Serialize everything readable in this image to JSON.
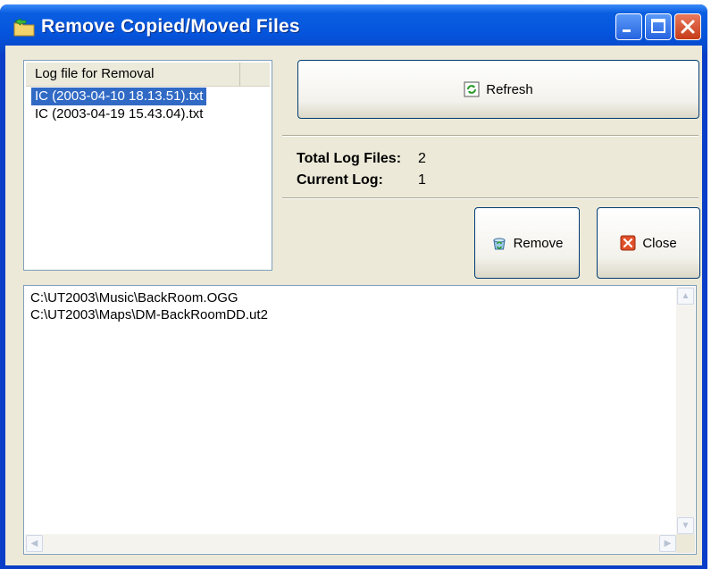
{
  "window": {
    "title": "Remove Copied/Moved Files"
  },
  "log_list": {
    "header": "Log file for Removal",
    "items": [
      {
        "label": "IC (2003-04-10  18.13.51).txt",
        "selected": true
      },
      {
        "label": "IC (2003-04-19  15.43.04).txt",
        "selected": false
      }
    ]
  },
  "buttons": {
    "refresh": "Refresh",
    "remove": "Remove",
    "close": "Close"
  },
  "info": {
    "total_label": "Total Log Files:",
    "total_value": "2",
    "current_label": "Current Log:",
    "current_value": "1"
  },
  "file_paths": [
    "C:\\UT2003\\Music\\BackRoom.OGG",
    "C:\\UT2003\\Maps\\DM-BackRoomDD.ut2"
  ],
  "icons": {
    "app": "folder-arrow-icon",
    "refresh": "refresh-icon",
    "remove": "recycle-icon",
    "close": "close-x-icon"
  }
}
